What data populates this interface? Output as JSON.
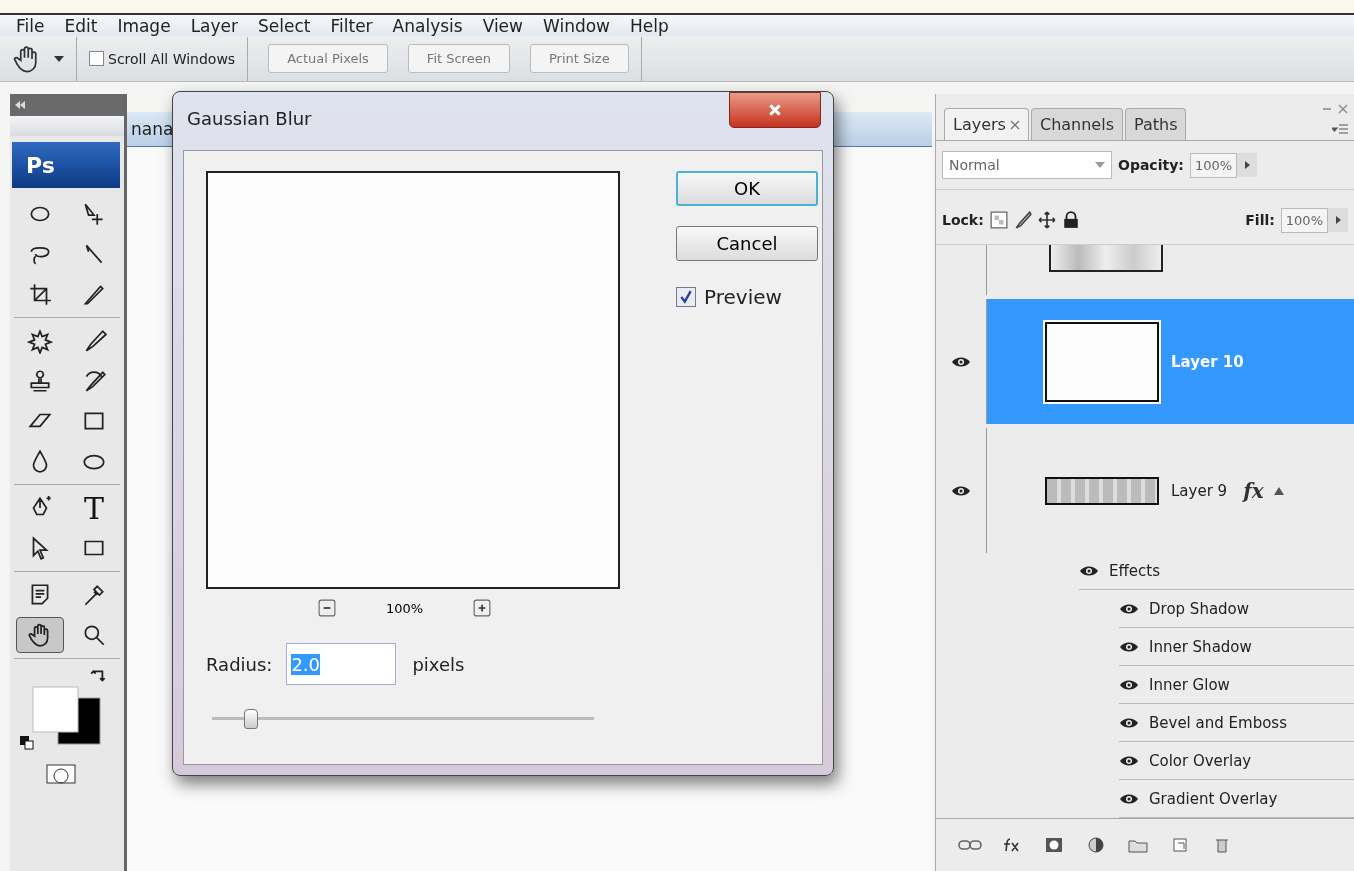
{
  "menu_bar": [
    "File",
    "Edit",
    "Image",
    "Layer",
    "Select",
    "Filter",
    "Analysis",
    "View",
    "Window",
    "Help"
  ],
  "options_bar": {
    "scroll_all_windows": {
      "label": "Scroll All Windows",
      "checked": false
    },
    "buttons": [
      "Actual Pixels",
      "Fit Screen",
      "Print Size"
    ]
  },
  "document": {
    "tab_title": "nana"
  },
  "toolbox": {
    "logo": "Ps",
    "groups": [
      [
        {
          "selected": false
        },
        {
          "selected": false
        },
        {
          "selected": false
        },
        {
          "selected": false
        },
        {
          "selected": false
        },
        {
          "selected": false
        }
      ],
      [
        {
          "selected": false
        },
        {
          "selected": false
        },
        {
          "selected": false
        },
        {
          "selected": false
        },
        {
          "selected": false
        },
        {
          "selected": false
        },
        {
          "selected": false
        },
        {
          "selected": false
        }
      ],
      [
        {
          "selected": false
        },
        {
          "label": "T",
          "selected": false
        },
        {
          "selected": false
        },
        {
          "selected": false
        }
      ],
      [
        {
          "selected": false
        },
        {
          "selected": false
        },
        {
          "selected": true
        },
        {
          "selected": false
        }
      ]
    ]
  },
  "dialog": {
    "title": "Gaussian Blur",
    "buttons": [
      "OK",
      "Cancel"
    ],
    "preview": {
      "label": "Preview",
      "checked": true
    },
    "zoom": "100%",
    "radius": {
      "label": "Radius:",
      "value": "2.0",
      "unit": "pixels"
    },
    "slider": {
      "level": 0.1
    }
  },
  "layers_panel": {
    "tabs": [
      {
        "label": "Layers",
        "selected": true
      },
      {
        "label": "Channels",
        "selected": false
      },
      {
        "label": "Paths",
        "selected": false
      }
    ],
    "blend_mode": "Normal",
    "opacity_label": "Opacity:",
    "opacity": "100%",
    "lock_label": "Lock:",
    "fill_label": "Fill:",
    "fill": "100%",
    "layers": [
      {
        "name": "Layer 10",
        "visible": true,
        "selected": true
      },
      {
        "name": "Layer 9",
        "visible": true,
        "selected": false,
        "fx_badge": "fx",
        "children": [
          {
            "name": "Effects",
            "visible": true,
            "children": [
              {
                "name": "Drop Shadow",
                "visible": true
              },
              {
                "name": "Inner Shadow",
                "visible": true
              },
              {
                "name": "Inner Glow",
                "visible": true
              },
              {
                "name": "Bevel and Emboss",
                "visible": true
              },
              {
                "name": "Color Overlay",
                "visible": true
              },
              {
                "name": "Gradient Overlay",
                "visible": true
              }
            ]
          }
        ]
      }
    ]
  }
}
